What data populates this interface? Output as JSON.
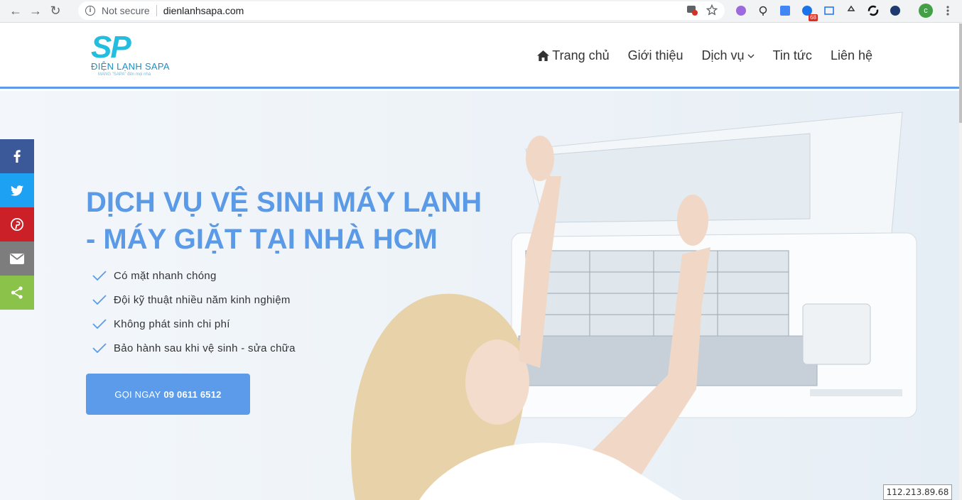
{
  "browser": {
    "security_label": "Not secure",
    "url": "dienlanhsapa.com",
    "extension_badge": "68",
    "profile_initial": "c"
  },
  "logo": {
    "mark": "SP",
    "brand": "ĐIỆN LẠNH SAPA",
    "tagline": "MANG \"SAPA\" đến mọi nhà"
  },
  "nav": {
    "items": [
      {
        "label": "Trang chủ"
      },
      {
        "label": "Giới thiệu"
      },
      {
        "label": "Dịch vụ"
      },
      {
        "label": "Tin tức"
      },
      {
        "label": "Liên hệ"
      }
    ]
  },
  "hero": {
    "headline_line1": "DỊCH VỤ VỆ SINH MÁY LẠNH",
    "headline_line2": "- MÁY GIẶT TẠI NHÀ HCM",
    "features": [
      "Có mặt nhanh chóng",
      "Đội kỹ thuật nhiều năm kinh nghiệm",
      "Không phát sinh chi phí",
      "Bảo hành sau khi vệ sinh - sửa chữa"
    ],
    "cta_prefix": "GỌI NGAY",
    "cta_phone": "09 0611 6512"
  },
  "share": {
    "colors": {
      "facebook": "#3b5998",
      "twitter": "#1da1f2",
      "pinterest": "#cb2027",
      "email": "#7d7d7d",
      "share": "#8bc34a"
    }
  },
  "ip_address": "112.213.89.68",
  "colors": {
    "accent": "#5b9be9",
    "headline": "#5a9ae6"
  }
}
